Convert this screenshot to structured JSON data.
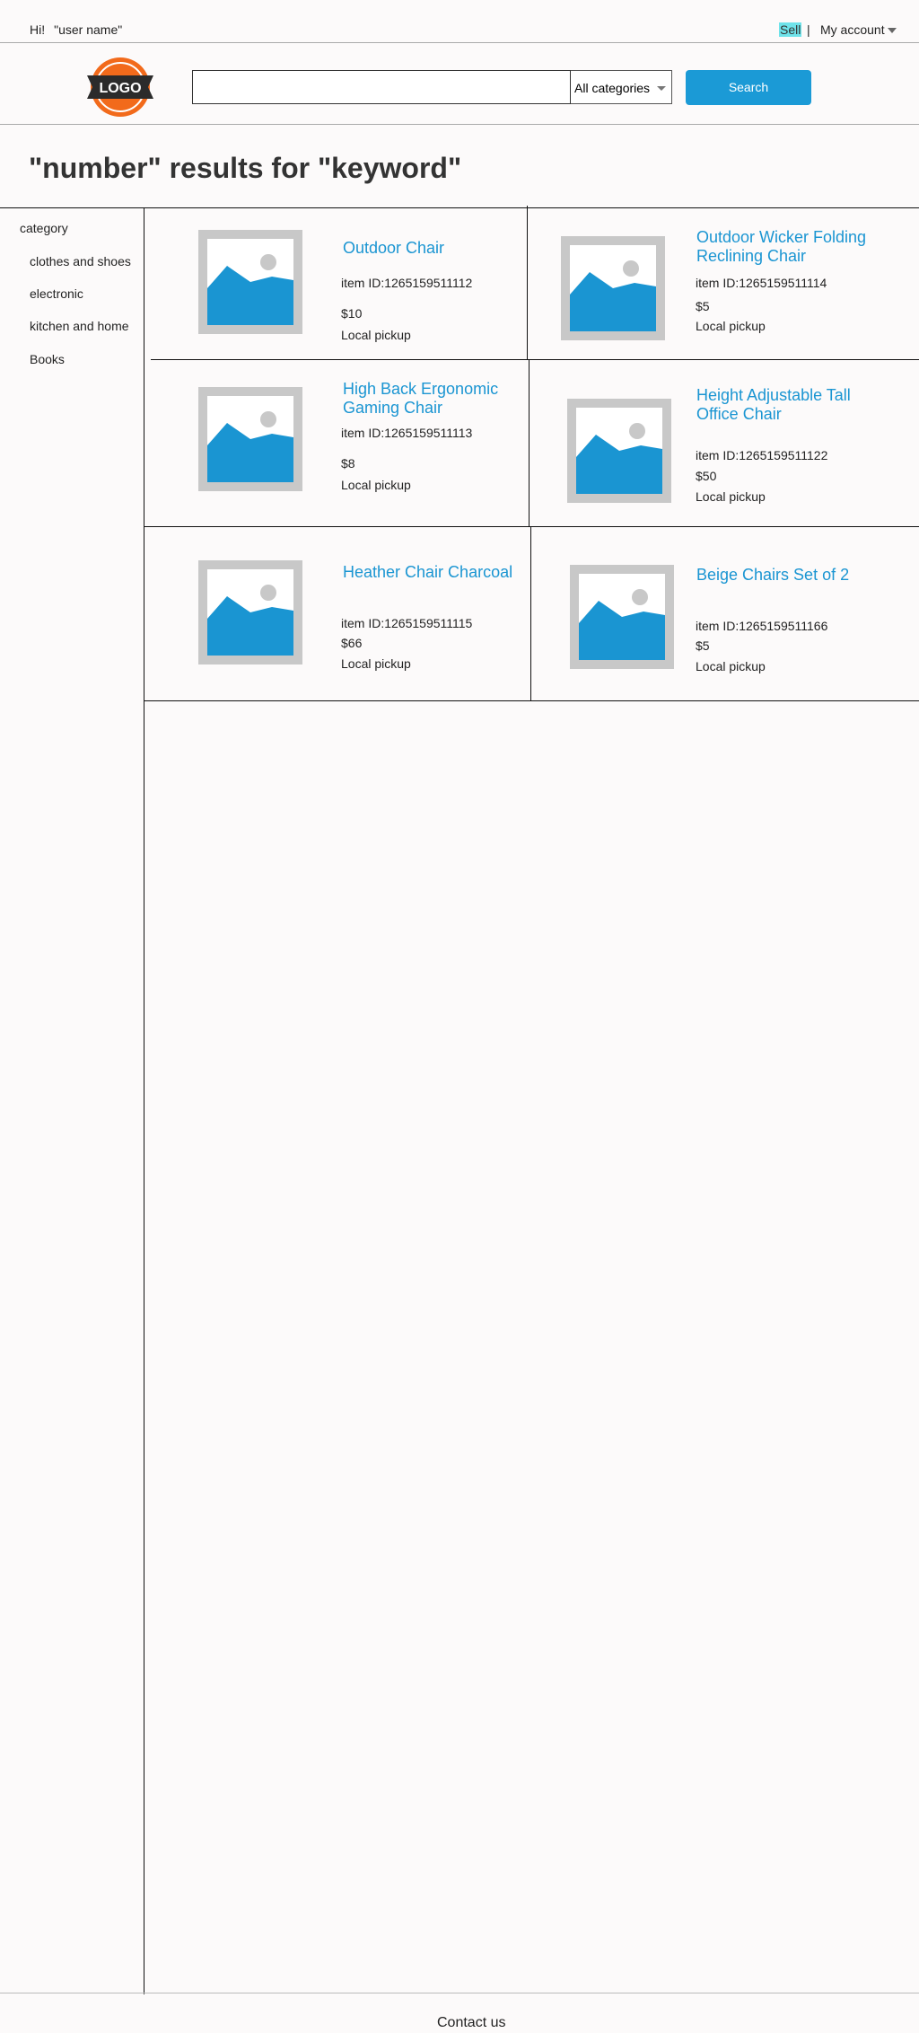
{
  "topbar": {
    "greeting_hi": "Hi!",
    "greeting_user": "\"user name\"",
    "sell_label": "Sell",
    "separator": "|",
    "account_label": "My account"
  },
  "header": {
    "logo_text": "LOGO",
    "search_value": "",
    "category_selected": "All categories",
    "search_button": "Search"
  },
  "results_title": "\"number\" results for \"keyword\"",
  "sidebar": {
    "heading": "category",
    "items": [
      {
        "label": "clothes and shoes"
      },
      {
        "label": "electronic"
      },
      {
        "label": "kitchen and home"
      },
      {
        "label": "Books"
      }
    ]
  },
  "products": [
    {
      "title": "Outdoor Chair",
      "item_id": "item ID:1265159511112",
      "price": "$10",
      "delivery": "Local pickup"
    },
    {
      "title": "Outdoor Wicker Folding Reclining Chair",
      "item_id": "item ID:1265159511114",
      "price": "$5",
      "delivery": "Local pickup"
    },
    {
      "title": "High Back Ergonomic Gaming Chair",
      "item_id": "item ID:1265159511113",
      "price": "$8",
      "delivery": "Local pickup"
    },
    {
      "title": "Height Adjustable Tall Office Chair",
      "item_id": "item ID:1265159511122",
      "price": "$50",
      "delivery": "Local pickup"
    },
    {
      "title": "Heather Chair Charcoal",
      "item_id": "item ID:1265159511115",
      "price": "$66",
      "delivery": "Local pickup"
    },
    {
      "title": "Beige Chairs Set of 2",
      "item_id": "item ID:1265159511166",
      "price": "$5",
      "delivery": "Local pickup"
    }
  ],
  "footer": {
    "contact_label": "Contact us"
  },
  "colors": {
    "accent": "#1b9ad6",
    "link": "#1a95d2",
    "sell_highlight": "#6fe3ea",
    "logo_orange": "#f26a1b"
  },
  "icons": {
    "logo": "logo-badge",
    "placeholder": "image-placeholder-icon",
    "caret": "chevron-down-icon"
  }
}
